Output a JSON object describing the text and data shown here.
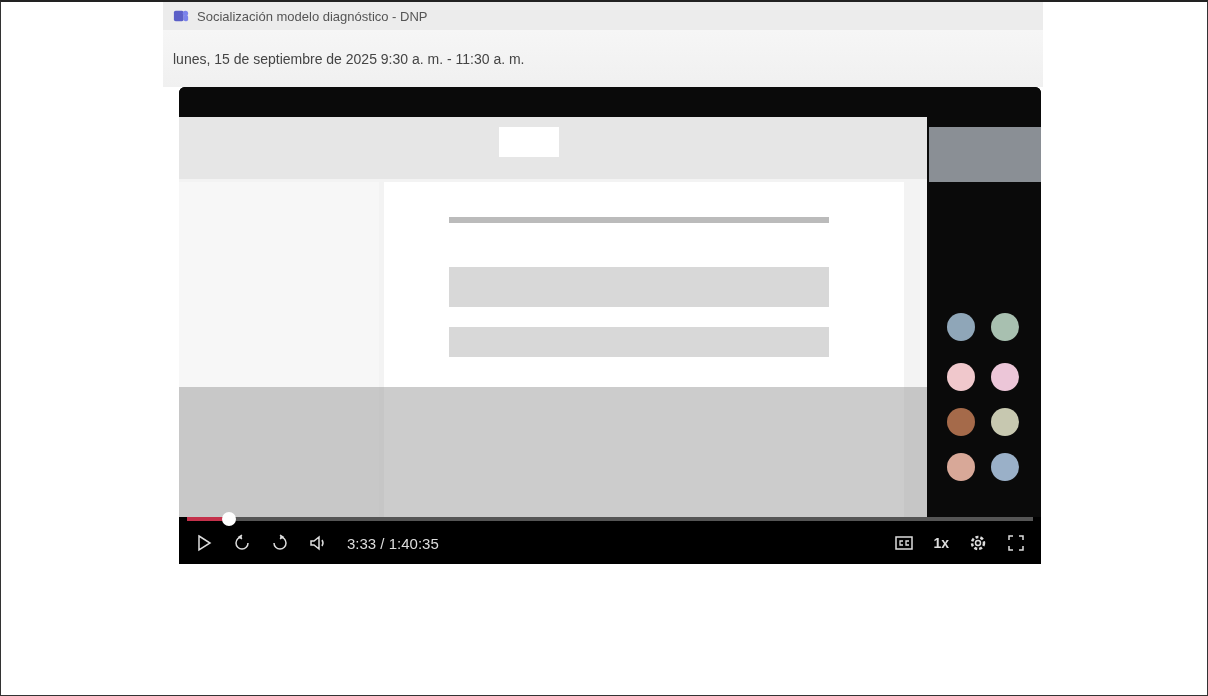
{
  "header": {
    "title": "Socialización modelo diagnóstico - DNP",
    "date": "lunes, 15 de septiembre de 2025 9:30 a. m. - 11:30 a. m."
  },
  "player": {
    "progress": {
      "level": 0.05
    },
    "time": "3:33 / 1:40:35",
    "speed": "1x"
  }
}
